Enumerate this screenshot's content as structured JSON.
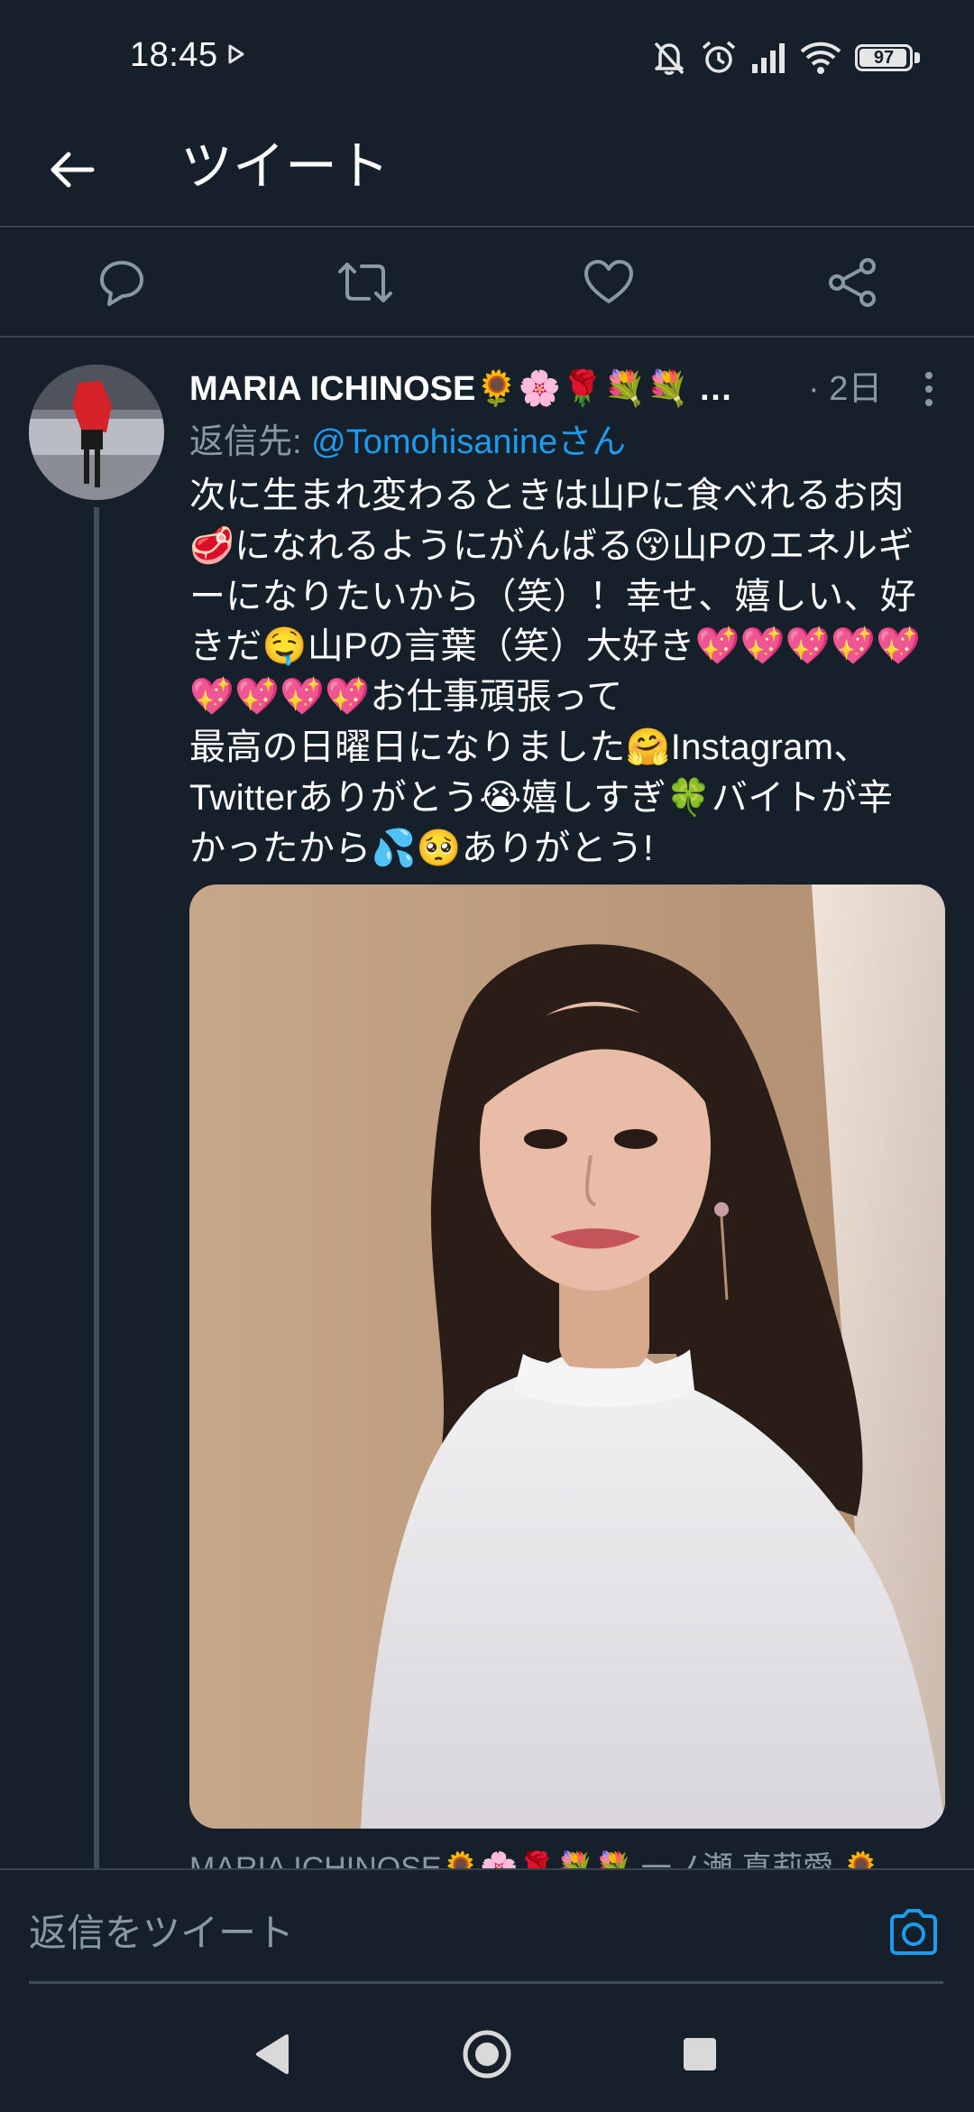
{
  "status_bar": {
    "time": "18:45",
    "battery": "97",
    "battery_level": 0.97,
    "icons": [
      "play-icon",
      "bell-off-icon",
      "alarm-icon",
      "signal-icon",
      "wifi-icon",
      "battery-icon"
    ]
  },
  "header": {
    "title": "ツイート"
  },
  "actions": [
    {
      "name": "reply",
      "icon": "comment-icon"
    },
    {
      "name": "retweet",
      "icon": "retweet-icon"
    },
    {
      "name": "like",
      "icon": "heart-icon"
    },
    {
      "name": "share",
      "icon": "share-icon"
    }
  ],
  "tweet": {
    "author_name": "MARIA ICHINOSE🌻🌸🌹💐💐 …",
    "time": "· 2日",
    "reply_prefix": "返信先: ",
    "reply_handle": "@Tomohisanineさん",
    "text": "次に生まれ変わるときは山Pに食べれるお肉\n🥩になれるようにがんばる😚山Pのエネルギ\nーになりたいから（笑）！幸せ、嬉しい、好\nきだ🤤山Pの言葉（笑）大好き💖💖💖💖💖\n💖💖💖💖お仕事頑張って\n最高の日曜日になりました🤗Instagram、\nTwitterありがとう😭嬉しすぎ🍀バイトが辛\nかったから💦🥺ありがとう!",
    "quoted_preview": "MARIA ICHINOSE🌻🌸🌹💐💐 一ノ瀬 真莉愛 🌻",
    "photo_alt": "selfie photo of a woman in a white sweater"
  },
  "reply_bar": {
    "placeholder": "返信をツイート"
  },
  "colors": {
    "background": "#15202b",
    "divider": "#38444d",
    "secondary_text": "#8899a6",
    "link": "#1d9bf0"
  }
}
